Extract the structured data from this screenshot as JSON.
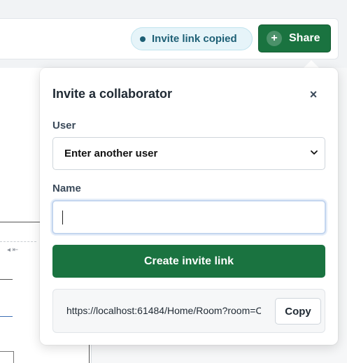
{
  "header": {
    "status_badge": "Invite link copied",
    "share_label": "Share",
    "share_icon": "+"
  },
  "dialog": {
    "title": "Invite a collaborator",
    "close_icon": "×",
    "user_label": "User",
    "user_select_value": "Enter another user",
    "name_label": "Name",
    "name_value": "",
    "create_button": "Create invite link",
    "invite_link": "https://localhost:61484/Home/Room?room=C",
    "copy_button": "Copy"
  },
  "colors": {
    "primary": "#1a7340",
    "badge_bg": "#e6f4f9",
    "badge_text": "#1d5f75"
  }
}
